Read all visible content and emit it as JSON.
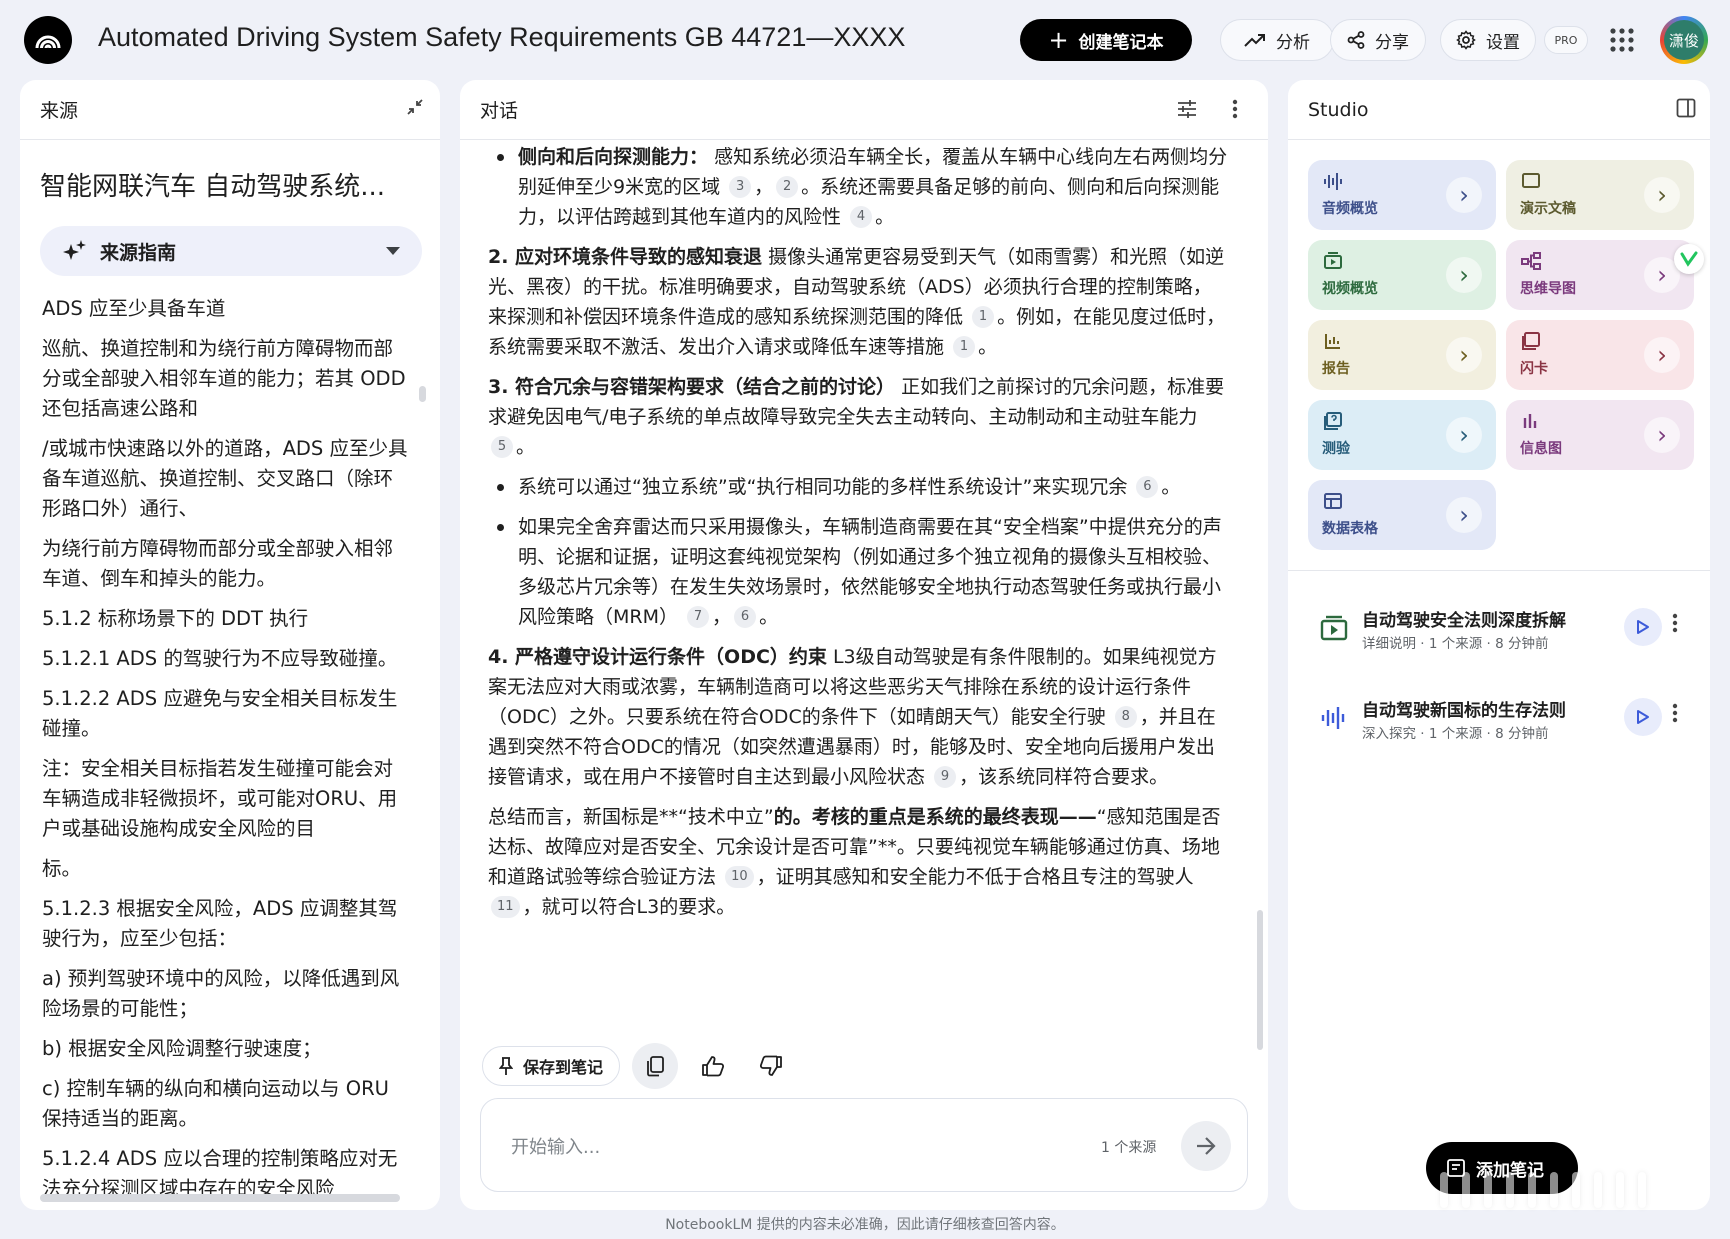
{
  "app": {
    "title": "Automated Driving System Safety Requirements GB 44721—XXXX",
    "create_notebook": "创建笔记本",
    "analyze": "分析",
    "share": "分享",
    "settings": "设置",
    "pro_badge": "PRO",
    "avatar_text": "潇俊"
  },
  "sources": {
    "header": "来源",
    "doc_title": "智能网联汽车 自动驾驶系统...",
    "guide_label": "来源指南",
    "paragraphs": [
      "ADS 应至少具备车道",
      "巡航、换道控制和为绕行前方障碍物而部分或全部驶入相邻车道的能力；若其 ODD 还包括高速公路和",
      "/或城市快速路以外的道路，ADS 应至少具备车道巡航、换道控制、交叉路口（除环形路口外）通行、",
      "为绕行前方障碍物而部分或全部驶入相邻车道、倒车和掉头的能力。",
      "5.1.2 标称场景下的 DDT 执行",
      "5.1.2.1 ADS 的驾驶行为不应导致碰撞。",
      "5.1.2.2 ADS 应避免与安全相关目标发生碰撞。",
      "注：安全相关目标指若发生碰撞可能会对车辆造成非轻微损坏，或可能对ORU、用户或基础设施构成安全风险的目",
      "标。",
      "5.1.2.3 根据安全风险，ADS 应调整其驾驶行为，应至少包括：",
      "a) 预判驾驶环境中的风险，以降低遇到风险场景的可能性；",
      "b) 根据安全风险调整行驶速度；",
      "c) 控制车辆的纵向和横向运动以与 ORU 保持适当的距离。",
      "5.1.2.4 ADS 应以合理的控制策略应对无法充分探测区域中存在的安全风险"
    ]
  },
  "chat": {
    "header": "对话",
    "bullet1": {
      "bold": "侧向和后向探测能力：",
      "text_a": "感知系统必须沿车辆全长，覆盖从车辆中心线向左右两侧均分别延伸至少9米宽的区域",
      "c1": "3",
      "sep": "，",
      "c2": "2",
      "text_b": "。系统还需要具备足够的前向、侧向和后向探测能力，以评估跨越到其他车道内的风险性",
      "c3": "4",
      "end": "。"
    },
    "p2": {
      "bold": "2. 应对环境条件导致的感知衰退",
      "text_a": "摄像头通常更容易受到天气（如雨雪雾）和光照（如逆光、黑夜）的干扰。标准明确要求，自动驾驶系统（ADS）必须执行合理的控制策略，来探测和补偿因环境条件造成的感知系统探测范围的降低",
      "c1": "1",
      "text_b": "。例如，在能见度过低时，系统需要采取不激活、发出介入请求或降低车速等措施",
      "c2": "1",
      "end": "。"
    },
    "p3": {
      "bold": "3. 符合冗余与容错架构要求（结合之前的讨论）",
      "text_a": "正如我们之前探讨的冗余问题，标准要求避免因电气/电子系统的单点故障导致完全失去主动转向、主动制动和主动驻车能力",
      "c1": "5",
      "end": "。"
    },
    "bullet2": {
      "text": "系统可以通过“独立系统”或“执行相同功能的多样性系统设计”来实现冗余",
      "c1": "6",
      "end": "。"
    },
    "bullet3": {
      "text": "如果完全舍弃雷达而只采用摄像头，车辆制造商需要在其“安全档案”中提供充分的声明、论据和证据，证明这套纯视觉架构（例如通过多个独立视角的摄像头互相校验、多级芯片冗余等）在发生失效场景时，依然能够安全地执行动态驾驶任务或执行最小风险策略（MRM）",
      "c1": "7",
      "sep": "，",
      "c2": "6",
      "end": "。"
    },
    "p4": {
      "bold": "4. 严格遵守设计运行条件（ODC）约束",
      "text_a": "L3级自动驾驶是有条件限制的。如果纯视觉方案无法应对大雨或浓雾，车辆制造商可以将这些恶劣天气排除在系统的设计运行条件（ODC）之外。只要系统在符合ODC的条件下（如晴朗天气）能安全行驶",
      "c1": "8",
      "text_b": "，并且在遇到突然不符合ODC的情况（如突然遭遇暴雨）时，能够及时、安全地向后援用户发出接管请求，或在用户不接管时自主达到最小风险状态",
      "c2": "9",
      "end": "，该系统同样符合要求。"
    },
    "summary": {
      "text_a": "总结而言，新国标是**“技术中立”",
      "bold": "的。考核的重点是系统的最终表现——",
      "text_b": "“感知范围是否达标、故障应对是否安全、冗余设计是否可靠”**。只要纯视觉车辆能够通过仿真、场地和道路试验等综合验证方法",
      "c1": "10",
      "text_c": "，证明其感知和安全能力不低于合格且专注的驾驶人",
      "c2": "11",
      "end": "，就可以符合L3的要求。"
    },
    "save_to_note": "保存到笔记",
    "input_placeholder": "开始输入...",
    "source_count": "1 个来源"
  },
  "studio": {
    "header": "Studio",
    "tiles": [
      {
        "label": "音频概览",
        "bg": "#e3e8f7",
        "fg": "#3d4f8a"
      },
      {
        "label": "演示文稿",
        "bg": "#efefe3",
        "fg": "#5c5a2f"
      },
      {
        "label": "视频概览",
        "bg": "#def0e3",
        "fg": "#2d6a3e"
      },
      {
        "label": "思维导图",
        "bg": "#f1e6f1",
        "fg": "#7b3a7d"
      },
      {
        "label": "报告",
        "bg": "#f2efdf",
        "fg": "#6d5f20"
      },
      {
        "label": "闪卡",
        "bg": "#f9e5e8",
        "fg": "#8a3444"
      },
      {
        "label": "测验",
        "bg": "#dcedf6",
        "fg": "#275d7a"
      },
      {
        "label": "信息图",
        "bg": "#f2e6f1",
        "fg": "#7b3a7d"
      },
      {
        "label": "数据表格",
        "bg": "#e3e8f7",
        "fg": "#3d4f8a"
      }
    ],
    "items": [
      {
        "title": "自动驾驶安全法则深度拆解",
        "subtitle": "详细说明 · 1 个来源 · 8 分钟前"
      },
      {
        "title": "自动驾驶新国标的生存法则",
        "subtitle": "深入探究 · 1 个来源 · 8 分钟前"
      }
    ],
    "add_note": "添加笔记"
  },
  "footer": {
    "disclaimer": "NotebookLM 提供的内容未必准确，因此请仔细核查回答内容。"
  }
}
